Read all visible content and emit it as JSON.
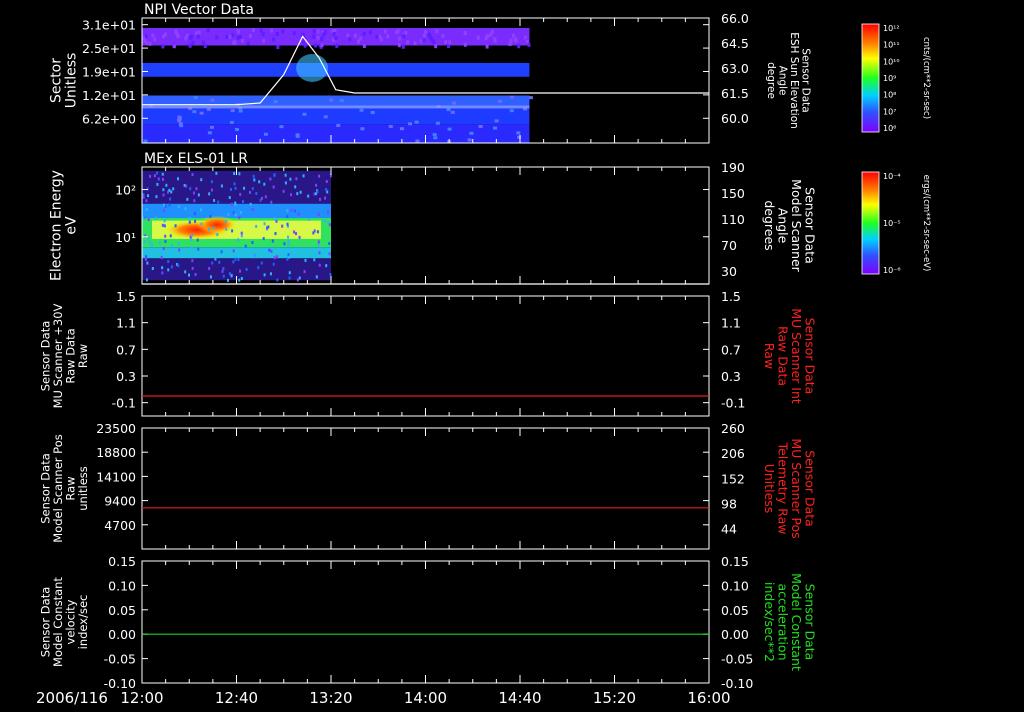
{
  "date_label": "2006/116",
  "time_ticks": [
    "12:00",
    "12:40",
    "13:20",
    "14:00",
    "14:40",
    "15:20",
    "16:00"
  ],
  "chart_data": [
    {
      "id": "npi",
      "type": "heatmap",
      "title": "NPI Vector Data",
      "ylabel": [
        "Sector",
        "Unitless"
      ],
      "ylabel_color": "#ffffff",
      "yticks_left": [
        "3.1e+01",
        "2.5e+01",
        "1.9e+01",
        "1.2e+01",
        "6.2e+00"
      ],
      "right_axis": {
        "label": [
          "Sensor Data",
          "ESH Sun Elevation",
          "Angle",
          "degree"
        ],
        "label_color": "#ffffff",
        "ticks": [
          "66.0",
          "64.5",
          "63.0",
          "61.5",
          "60.0"
        ],
        "range": [
          58.5,
          66.0
        ]
      },
      "data_end": "14:44",
      "line_series": {
        "name": "ESH Sun Elevation Angle",
        "color": "#ffffff",
        "x": [
          "12:00",
          "12:40",
          "12:50",
          "13:00",
          "13:08",
          "13:15",
          "13:22",
          "13:30",
          "16:00"
        ],
        "y": [
          60.8,
          60.8,
          60.9,
          62.6,
          64.9,
          63.6,
          61.7,
          61.5,
          61.5
        ]
      },
      "colorbar": {
        "label": "NF",
        "unit": "cnts/(cm**2-sr-sec)",
        "ticks": [
          "10¹²",
          "10¹¹",
          "10¹⁰",
          "10⁹",
          "10⁸",
          "10⁷",
          "10⁶"
        ]
      }
    },
    {
      "id": "els",
      "type": "heatmap",
      "title": "MEx ELS-01 LR",
      "ylabel": [
        "Electron Energy",
        "eV"
      ],
      "ylabel_color": "#ffffff",
      "yticks_left": [
        "10²",
        "10¹"
      ],
      "ylim": [
        1,
        300
      ],
      "yscale": "log",
      "right_axis": {
        "label": [
          "Sensor Data",
          "Model Scanner",
          "Angle",
          "degrees"
        ],
        "label_color": "#ffffff",
        "ticks": [
          "190",
          "150",
          "110",
          "70",
          "30"
        ],
        "range": [
          10,
          190
        ]
      },
      "data_end": "13:20",
      "line_series": {
        "name": "Model Scanner Angle",
        "color": "#ffffff",
        "x": [
          "12:00",
          "16:00"
        ],
        "y": [
          10,
          10
        ]
      },
      "colorbar": {
        "label": "DEF",
        "unit": "ergs/(cm**2-sr-sec-eV)",
        "ticks": [
          "10⁻⁴",
          "10⁻⁵",
          "10⁻⁶"
        ]
      }
    },
    {
      "id": "mu-raw",
      "type": "line",
      "ylabel": [
        "Sensor Data",
        "MU Scanner +30V",
        "Raw Data",
        "Raw"
      ],
      "ylabel_color": "#ffffff",
      "yticks_left": [
        "1.5",
        "1.1",
        "0.7",
        "0.3",
        "-0.1"
      ],
      "ylim": [
        -0.3,
        1.5
      ],
      "right_axis": {
        "label": [
          "Sensor Data",
          "MU Scanner Int",
          "Raw Data",
          "Raw"
        ],
        "label_color": "#ff2020",
        "ticks": [
          "1.5",
          "1.1",
          "0.7",
          "0.3",
          "-0.1"
        ],
        "range": [
          -0.3,
          1.5
        ]
      },
      "series": [
        {
          "color": "#e02020",
          "x": [
            "12:00",
            "16:00"
          ],
          "y": [
            0.0,
            0.0
          ]
        }
      ]
    },
    {
      "id": "mu-pos",
      "type": "line",
      "ylabel": [
        "Sensor Data",
        "Model Scanner Pos",
        "Raw",
        "unitless"
      ],
      "ylabel_color": "#ffffff",
      "yticks_left": [
        "23500",
        "18800",
        "14100",
        "9400",
        "4700"
      ],
      "ylim": [
        0,
        23500
      ],
      "right_axis": {
        "label": [
          "Sensor Data",
          "MU Scanner Pos",
          "Telemetry Raw",
          "Unitless"
        ],
        "label_color": "#ff2020",
        "ticks": [
          "260",
          "206",
          "152",
          "98",
          "44"
        ],
        "range": [
          0,
          260
        ]
      },
      "series": [
        {
          "color": "#e02020",
          "x": [
            "12:00",
            "16:00"
          ],
          "y": [
            8000,
            8000
          ]
        }
      ]
    },
    {
      "id": "vel",
      "type": "line",
      "ylabel": [
        "Sensor Data",
        "Model Constant",
        "velocity",
        "index/sec"
      ],
      "ylabel_color": "#ffffff",
      "yticks_left": [
        "0.15",
        "0.10",
        "0.05",
        "0.00",
        "-0.05",
        "-0.10"
      ],
      "ylim": [
        -0.1,
        0.15
      ],
      "right_axis": {
        "label": [
          "Sensor Data",
          "Model Constant",
          "acceleration",
          "index/sec**2"
        ],
        "label_color": "#20e020",
        "ticks": [
          "0.15",
          "0.10",
          "0.05",
          "0.00",
          "-0.05",
          "-0.10"
        ],
        "range": [
          -0.1,
          0.15
        ]
      },
      "series": [
        {
          "color": "#20d020",
          "x": [
            "12:00",
            "16:00"
          ],
          "y": [
            0.0,
            0.0
          ]
        }
      ]
    }
  ]
}
